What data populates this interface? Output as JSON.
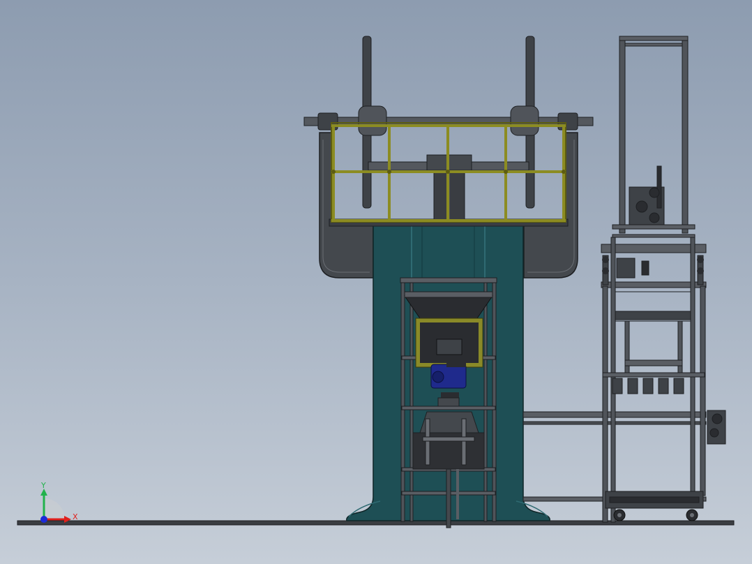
{
  "triad": {
    "x_label": "X",
    "y_label": "Y",
    "x_color": "#e0201c",
    "y_color": "#22b24c",
    "z_color": "#1c2ad8"
  },
  "palette": {
    "press_body": "#1e4f55",
    "railing": "#8c8c22",
    "steel_dark": "#3a3d42",
    "steel_mid": "#5a5e64",
    "motor_blue": "#1f2a8c",
    "floor": "#3a3d42"
  },
  "model": {
    "components": [
      "hydraulic-press",
      "flywheel",
      "safety-railing",
      "feed-hopper",
      "drive-motor",
      "frame-cart",
      "floor-plate"
    ]
  }
}
